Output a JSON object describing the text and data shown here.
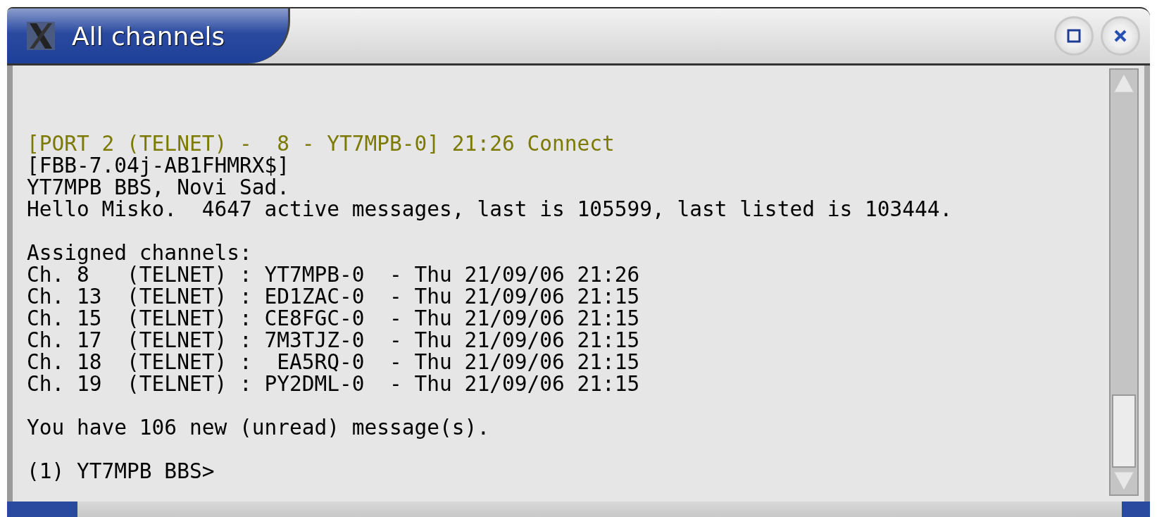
{
  "window": {
    "title": "All channels"
  },
  "terminal": {
    "blocks": [
      [
        {
          "kind": "status",
          "text": "[PORT 2 (TELNET) -  8 - YT7MPB-0] 21:26 Connect"
        },
        {
          "kind": "text",
          "text": "[FBB-7.04j-AB1FHMRX$]"
        },
        {
          "kind": "text",
          "text": "YT7MPB BBS, Novi Sad."
        },
        {
          "kind": "text",
          "text": "Hello Misko.  4647 active messages, last is 105599, last listed is 103444."
        }
      ],
      [
        {
          "kind": "text",
          "text": "Assigned channels:"
        },
        {
          "kind": "text",
          "text": "Ch. 8   (TELNET) : YT7MPB-0  - Thu 21/09/06 21:26"
        },
        {
          "kind": "text",
          "text": "Ch. 13  (TELNET) : ED1ZAC-0  - Thu 21/09/06 21:15"
        },
        {
          "kind": "text",
          "text": "Ch. 15  (TELNET) : CE8FGC-0  - Thu 21/09/06 21:15"
        },
        {
          "kind": "text",
          "text": "Ch. 17  (TELNET) : 7M3TJZ-0  - Thu 21/09/06 21:15"
        },
        {
          "kind": "text",
          "text": "Ch. 18  (TELNET) :  EA5RQ-0  - Thu 21/09/06 21:15"
        },
        {
          "kind": "text",
          "text": "Ch. 19  (TELNET) : PY2DML-0  - Thu 21/09/06 21:15"
        }
      ],
      [
        {
          "kind": "text",
          "text": "You have 106 new (unread) message(s)."
        }
      ],
      [
        {
          "kind": "text",
          "text": "(1) YT7MPB BBS>"
        }
      ]
    ]
  }
}
